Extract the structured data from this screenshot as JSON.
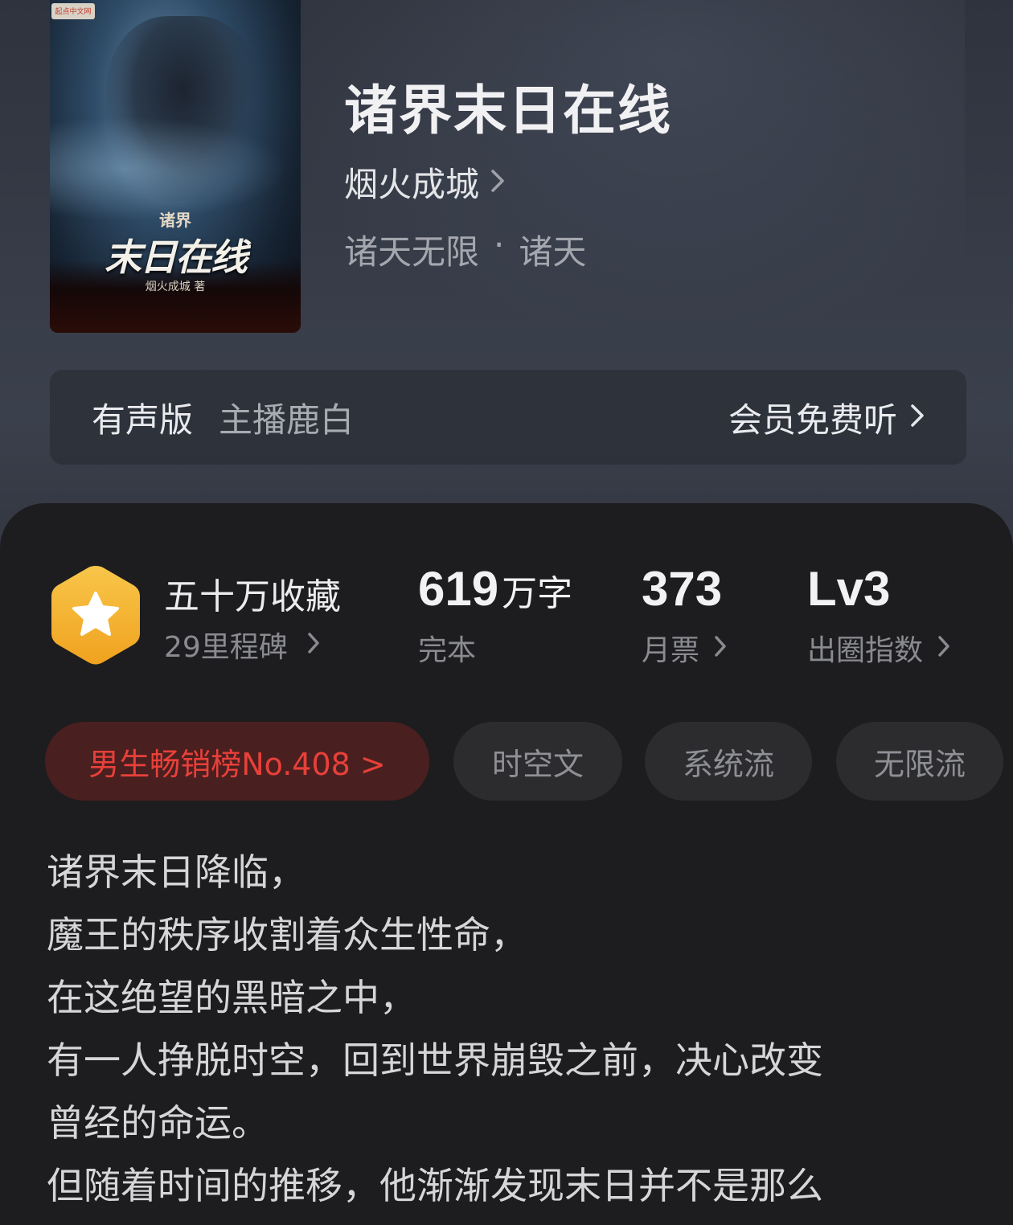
{
  "book": {
    "title": "诸界末日在线",
    "author": "烟火成城",
    "genre": "诸天无限",
    "genre_sep": "·",
    "subgenre": "诸天"
  },
  "cover": {
    "badge": "起点中文网",
    "small": "诸界",
    "title": "末日在线",
    "author": "烟火成城 著"
  },
  "audio": {
    "label": "有声版",
    "host": "主播鹿白",
    "cta": "会员免费听"
  },
  "stats": {
    "collect_main": "五十万收藏",
    "collect_sub": "29里程碑",
    "words_num": "619",
    "words_unit": "万字",
    "words_sub": "完本",
    "tickets_num": "373",
    "tickets_sub": "月票",
    "index_num": "Lv3",
    "index_sub": "出圈指数"
  },
  "tags": {
    "rank": "男生畅销榜No.408 >",
    "tag1": "时空文",
    "tag2": "系统流",
    "tag3": "无限流"
  },
  "synopsis": [
    "诸界末日降临，",
    "魔王的秩序收割着众生性命，",
    "在这绝望的黑暗之中，",
    "有一人挣脱时空，回到世界崩毁之前，决心改变",
    "曾经的命运。",
    "但随着时间的推移，他渐渐发现末日并不是那么"
  ],
  "colors": {
    "accent_red": "#e8403a",
    "rank_bg": "#4a1f1f",
    "badge_gold": "#f5b633"
  },
  "icons": {
    "author_chevron": "chevron-right-icon",
    "milestone": "star-hexagon-icon"
  }
}
